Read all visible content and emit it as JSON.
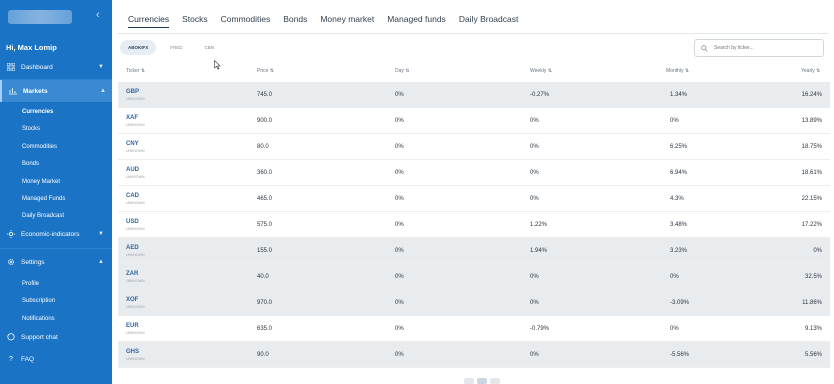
{
  "sidebar": {
    "greeting": "Hi, Max Lomip",
    "nav": [
      {
        "label": "Dashboard",
        "icon": "grid-icon"
      },
      {
        "label": "Markets",
        "icon": "chart-icon"
      },
      {
        "label": "Economic-indicators",
        "icon": "sun-icon"
      },
      {
        "label": "Settings",
        "icon": "gear-icon"
      },
      {
        "label": "Support chat",
        "icon": "chat-icon"
      },
      {
        "label": "FAQ",
        "icon": "question-icon"
      }
    ],
    "markets_sub": [
      "Currencies",
      "Stocks",
      "Commodities",
      "Bonds",
      "Money Market",
      "Managed Funds",
      "Daily Broadcast"
    ],
    "settings_sub": [
      "Profile",
      "Subscription",
      "Notifications"
    ]
  },
  "tabs": [
    "Currencies",
    "Stocks",
    "Commodities",
    "Bonds",
    "Money market",
    "Managed funds",
    "Daily Broadcast"
  ],
  "sources": [
    "ABOKIFX",
    "FRED",
    "CBN"
  ],
  "search": {
    "placeholder": "Search by ticker..."
  },
  "table": {
    "headers": [
      "Ticker",
      "Price",
      "Day",
      "Weekly",
      "Monthly",
      "Yearly"
    ],
    "rows": [
      {
        "ticker": "GBP",
        "sub": "UNKNOWN",
        "price": "745.0",
        "day": "0%",
        "weekly": "-0.27%",
        "monthly": "1.34%",
        "yearly": "16.24%"
      },
      {
        "ticker": "XAF",
        "sub": "UNKNOWN",
        "price": "900.0",
        "day": "0%",
        "weekly": "0%",
        "monthly": "0%",
        "yearly": "13.89%"
      },
      {
        "ticker": "CNY",
        "sub": "UNKNOWN",
        "price": "80.0",
        "day": "0%",
        "weekly": "0%",
        "monthly": "6.25%",
        "yearly": "18.75%"
      },
      {
        "ticker": "AUD",
        "sub": "UNKNOWN",
        "price": "360.0",
        "day": "0%",
        "weekly": "0%",
        "monthly": "6.94%",
        "yearly": "18.61%"
      },
      {
        "ticker": "CAD",
        "sub": "UNKNOWN",
        "price": "465.0",
        "day": "0%",
        "weekly": "0%",
        "monthly": "4.3%",
        "yearly": "22.15%"
      },
      {
        "ticker": "USD",
        "sub": "UNKNOWN",
        "price": "575.0",
        "day": "0%",
        "weekly": "1.22%",
        "monthly": "3.48%",
        "yearly": "17.22%"
      },
      {
        "ticker": "AED",
        "sub": "UNKNOWN",
        "price": "155.0",
        "day": "0%",
        "weekly": "1.94%",
        "monthly": "3.23%",
        "yearly": "0%"
      },
      {
        "ticker": "ZAR",
        "sub": "UNKNOWN",
        "price": "40.0",
        "day": "0%",
        "weekly": "0%",
        "monthly": "0%",
        "yearly": "32.5%"
      },
      {
        "ticker": "XOF",
        "sub": "UNKNOWN",
        "price": "970.0",
        "day": "0%",
        "weekly": "0%",
        "monthly": "-3.09%",
        "yearly": "11.86%"
      },
      {
        "ticker": "EUR",
        "sub": "UNKNOWN",
        "price": "635.0",
        "day": "0%",
        "weekly": "-0.79%",
        "monthly": "0%",
        "yearly": "9.13%"
      },
      {
        "ticker": "GHS",
        "sub": "UNKNOWN",
        "price": "90.0",
        "day": "0%",
        "weekly": "0%",
        "monthly": "-5.56%",
        "yearly": "5.56%"
      }
    ]
  },
  "colors": {
    "sidebar": "#1a73c4",
    "active_nav": "#3a8ad3",
    "ticker": "#2f64a3",
    "shade_row": "#e9ecef"
  }
}
